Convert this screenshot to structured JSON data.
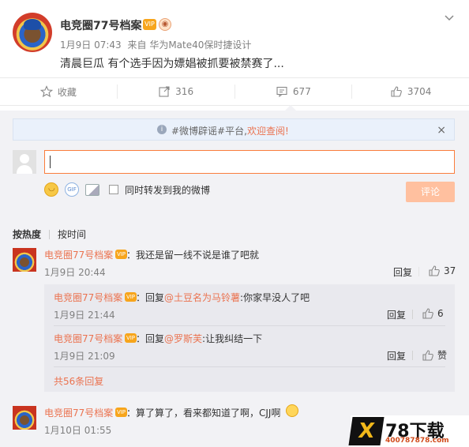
{
  "post": {
    "author": "电竞圈77号档案",
    "vip_badge": "VIP",
    "date": "1月9日 07:43",
    "source": "来自 华为Mate40保时捷设计",
    "text": "清晨巨瓜 有个选手因为嫖娼被抓要被禁赛了..."
  },
  "actions": {
    "favorite": "收藏",
    "repost_count": "316",
    "comment_count": "677",
    "like_count": "3704"
  },
  "notice": {
    "prefix": "#微博辟谣#平台,",
    "link": "欢迎查阅!",
    "close": "×"
  },
  "compose": {
    "placeholder": "",
    "repost_label": "同时转发到我的微博",
    "submit": "评论"
  },
  "sort": {
    "hot": "按热度",
    "time": "按时间"
  },
  "comments": [
    {
      "author": "电竞圈77号档案",
      "text": "：我还是留一线不说是谁了吧就",
      "time": "1月9日 20:44",
      "reply": "回复",
      "likes": "37"
    },
    {
      "author": "电竞圈77号档案",
      "text": "：算了算了，看来都知道了啊，CJJ啊",
      "time": "1月10日 01:55"
    }
  ],
  "replies": [
    {
      "author": "电竞圈77号档案",
      "prefix": "：回复",
      "mention": "@土豆名为马铃薯",
      "text": ":你家早没人了吧",
      "time": "1月9日 21:44",
      "reply": "回复",
      "likes": "6"
    },
    {
      "author": "电竞圈77号档案",
      "prefix": "：回复",
      "mention": "@罗斯芙",
      "text": ":让我纠结一下",
      "time": "1月9日 21:09",
      "reply": "回复",
      "likes": "赞"
    }
  ],
  "more_replies": "共56条回复",
  "watermark": {
    "x": "X",
    "brand": "78下载",
    "url": "400787878.com"
  }
}
